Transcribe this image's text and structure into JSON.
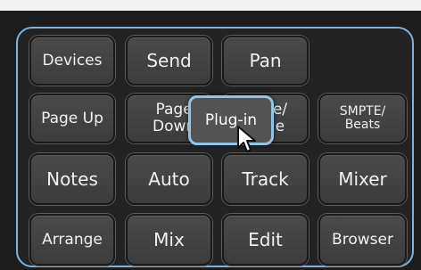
{
  "keys": {
    "devices": "Devices",
    "send": "Send",
    "pan": "Pan",
    "page_up": "Page Up",
    "page_down": "Page\nDown",
    "hidden_key_partial": "e/\ne",
    "smpte_beats": "SMPTE/\nBeats",
    "notes": "Notes",
    "auto": "Auto",
    "track": "Track",
    "mixer": "Mixer",
    "arrange": "Arrange",
    "mix": "Mix",
    "edit": "Edit",
    "browser": "Browser"
  },
  "popup": {
    "label": "Plug-in"
  },
  "colors": {
    "panel_border": "#7fb1d9",
    "popup_border": "#8fc3e8",
    "key_text": "#f0f0f0"
  },
  "icons": {
    "cursor": "arrow-cursor-icon"
  }
}
